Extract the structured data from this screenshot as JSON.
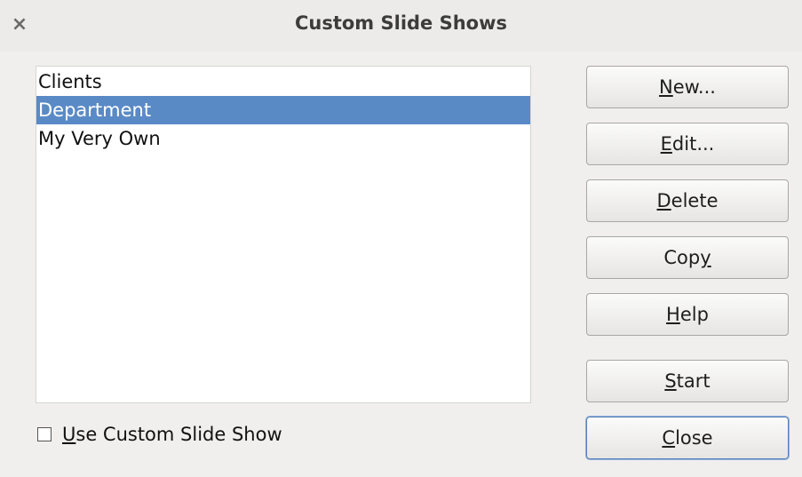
{
  "window": {
    "title": "Custom Slide Shows",
    "close_glyph": "×"
  },
  "list": {
    "items": [
      {
        "label": "Clients",
        "selected": false
      },
      {
        "label": "Department",
        "selected": true
      },
      {
        "label": "My Very Own",
        "selected": false
      }
    ]
  },
  "buttons": {
    "new": "New...",
    "edit": "Edit...",
    "delete": "Delete",
    "copy": "Copy",
    "help": "Help",
    "start": "Start",
    "close": "Close"
  },
  "options": {
    "use_custom_label": "Use Custom Slide Show",
    "use_custom_checked": false
  },
  "colors": {
    "selection": "#5a8ac6",
    "dialog_bg": "#f0efee"
  }
}
